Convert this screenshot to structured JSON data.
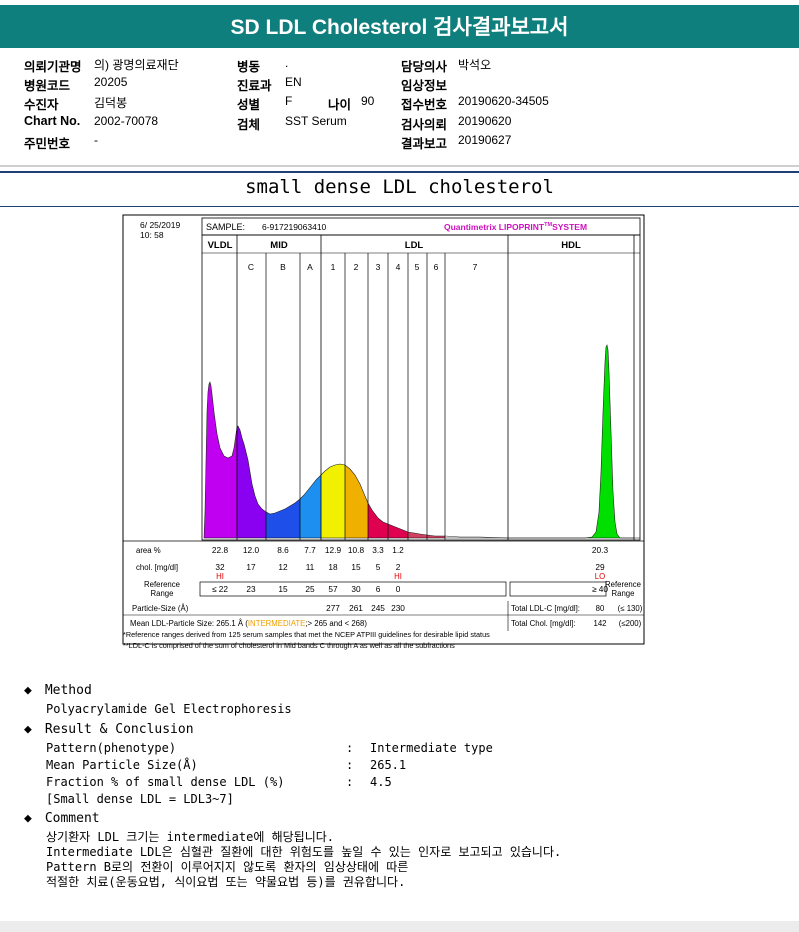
{
  "header": {
    "title": "SD LDL Cholesterol 검사결과보고서"
  },
  "info": {
    "col1": [
      {
        "label": "의뢰기관명",
        "value": "의) 광명의료재단"
      },
      {
        "label": "병원코드",
        "value": "20205"
      },
      {
        "label": "수진자",
        "value": "김덕봉"
      },
      {
        "label": "Chart No.",
        "value": "2002-70078"
      },
      {
        "label": "주민번호",
        "value": "-"
      }
    ],
    "col2": [
      {
        "label": "병동",
        "value": "."
      },
      {
        "label": "진료과",
        "value": "EN"
      },
      {
        "label": "성별",
        "value": "F"
      },
      {
        "label": "검체",
        "value": "SST Serum"
      }
    ],
    "age": {
      "label": "나이",
      "value": "90"
    },
    "col3": [
      {
        "label": "담당의사",
        "value": "박석오"
      },
      {
        "label": "임상정보",
        "value": ""
      },
      {
        "label": "접수번호",
        "value": "20190620-34505"
      },
      {
        "label": "검사의뢰",
        "value": "20190620"
      },
      {
        "label": "결과보고",
        "value": "20190627"
      }
    ]
  },
  "subtitle": "small dense LDL cholesterol",
  "report": {
    "date": "6/ 25/2019",
    "time": "10: 58",
    "sample_label": "SAMPLE:",
    "sample_id": "6-917219063410",
    "brand": "Quantimetrix LIPOPRINT",
    "brand_tm": "TM",
    "brand_suffix": "SYSTEM",
    "groups": [
      "VLDL",
      "MID",
      "LDL",
      "HDL"
    ],
    "bands": [
      "C",
      "B",
      "A",
      "1",
      "2",
      "3",
      "4",
      "5",
      "6",
      "7"
    ],
    "area_label": "area %",
    "chol_label": "chol. [mg/dl]",
    "ref_label": "Reference\nRange",
    "ref_label_right": "Reference\nRange",
    "particle_label": "Particle-Size (Å)",
    "mean_label": "Mean LDL-Particle Size:",
    "mean_value": "265.1 Å",
    "mean_open": "(",
    "mean_status": "INTERMEDIATE",
    "mean_range": ";> 265 and < 268)",
    "total_ldl_label": "Total LDL-C [mg/dl]:",
    "total_ldl_value": "80",
    "total_ldl_ref": "(≤ 130)",
    "total_chol_label": "Total Chol. [mg/dl]:",
    "total_chol_value": "142",
    "total_chol_ref": "(≤200)",
    "footnote1": "*Reference ranges derived from 125 serum samples that met the NCEP ATPIII guidelines for desirable lipid status",
    "footnote2": "**LDL-C is comprised of the sum of cholesterol in Mid bands C through A as well as all the subfractions",
    "hi_label": "HI",
    "lo_label": "LO"
  },
  "chart_data": {
    "type": "area",
    "categories": [
      "VLDL",
      "MID C",
      "MID B",
      "MID A",
      "LDL 1",
      "LDL 2",
      "LDL 3",
      "LDL 4",
      "LDL 5",
      "LDL 6",
      "LDL 7",
      "HDL"
    ],
    "series": [
      {
        "values": [
          22.8,
          12.0,
          8.6,
          7.7,
          12.9,
          10.8,
          3.3,
          1.2,
          null,
          null,
          null,
          20.3
        ]
      },
      {
        "values": [
          32,
          17,
          12,
          11,
          18,
          15,
          5,
          2,
          null,
          null,
          null,
          29
        ]
      },
      {
        "values": [
          "≤ 22",
          "23",
          "15",
          "25",
          "57",
          "30",
          "6",
          "0",
          null,
          null,
          null,
          "≥ 40"
        ]
      },
      {
        "values": [
          null,
          null,
          null,
          null,
          277,
          261,
          245,
          230,
          null,
          null,
          null,
          null
        ]
      }
    ],
    "flags": {
      "VLDL": "HI",
      "LDL 4": "HI",
      "HDL": "LO"
    },
    "colors": [
      "#c000f0",
      "#8a00f0",
      "#1e4fe8",
      "#1c8ff0",
      "#f0f000",
      "#f0b000",
      "#e00050",
      "#e00050",
      "#d04060",
      "#d04060",
      "#ff8080",
      "#00e000"
    ]
  },
  "sections": {
    "method_title": "Method",
    "method_text": "Polyacrylamide Gel Electrophoresis",
    "result_title": "Result & Conclusion",
    "results": [
      {
        "label": "Pattern(phenotype)",
        "colon": ":",
        "value": "Intermediate type"
      },
      {
        "label": "Mean Particle Size(Å)",
        "colon": ":",
        "value": "265.1"
      },
      {
        "label": "Fraction % of small dense LDL (%)",
        "colon": ":",
        "value": "4.5"
      }
    ],
    "result_note": "[Small dense LDL = LDL3~7]",
    "comment_title": "Comment",
    "comments": [
      "상기환자 LDL 크기는 intermediate에 해당됩니다.",
      "Intermediate LDL은 심혈관 질환에 대한 위험도를 높일 수 있는 인자로 보고되고 있습니다.",
      "Pattern B로의 전환이 이루어지지 않도록 환자의 임상상태에 따른",
      "적절한 치료(운동요법, 식이요법 또는 약물요법 등)를 권유합니다."
    ],
    "bullet": "◆"
  }
}
